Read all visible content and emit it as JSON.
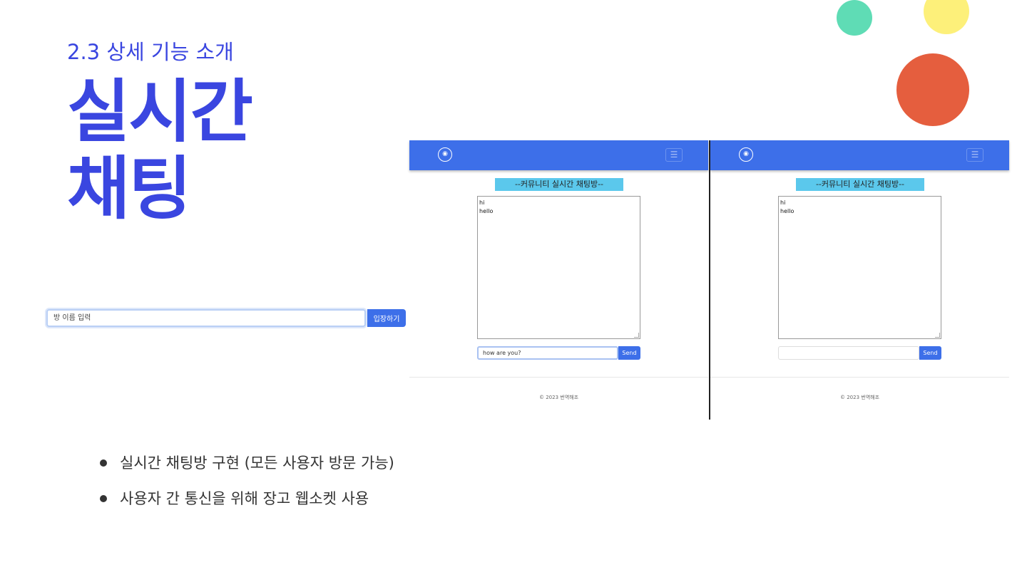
{
  "slide": {
    "section_label": "2.3 상세 기능 소개",
    "title_line1": "실시간",
    "title_line2": "채팅",
    "colors": {
      "accent": "#3a46e0",
      "navbar": "#3d6fe9",
      "title_bar": "#5bc8ec"
    }
  },
  "room_entry": {
    "placeholder": "방 이름 입력",
    "button_label": "입장하기"
  },
  "chat_left": {
    "logo_icon": "app-logo-icon",
    "menu_icon": "hamburger-menu-icon",
    "room_title": "--커뮤니티 실시간 채팅방--",
    "messages": [
      "hi",
      "hello"
    ],
    "input_value": "how are you?",
    "send_label": "Send",
    "footer": "© 2023 번역해조"
  },
  "chat_right": {
    "logo_icon": "app-logo-icon",
    "menu_icon": "hamburger-menu-icon",
    "room_title": "--커뮤니티 실시간 채팅방--",
    "messages": [
      "hi",
      "hello"
    ],
    "input_value": "",
    "send_label": "Send",
    "footer": "© 2023 번역해조"
  },
  "bullets": [
    "실시간 채팅방 구현 (모든 사용자 방문 가능)",
    "사용자 간 통신을 위해 장고 웹소켓 사용"
  ]
}
